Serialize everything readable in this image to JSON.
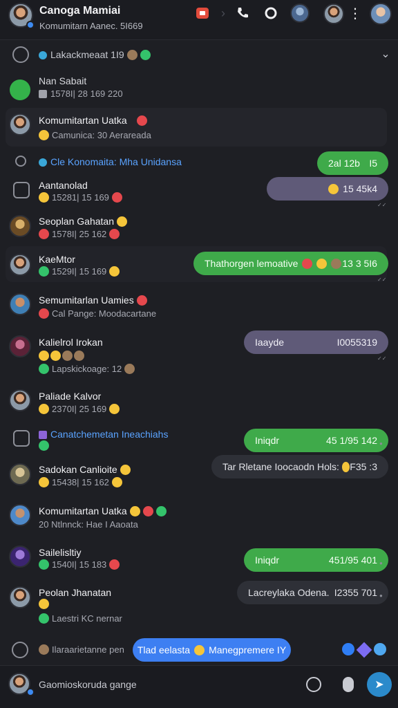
{
  "header": {
    "title": "Canoga Mamiai",
    "subtitle": "Komumitarn Aanec. 5I669"
  },
  "summary": {
    "label": "Lakackmeaat 1I9"
  },
  "pinned": {
    "name": "Nan Sabait",
    "meta": "1578I| 28 169 220"
  },
  "rows": [
    {
      "name": "Komumitartan Uatka",
      "meta": "Camunica: 30 Aerareada"
    },
    {
      "name": "Aantanolad",
      "meta": "15281| 15 169"
    },
    {
      "name": "Seoplan Gahatan",
      "meta": "1578I| 25 162"
    },
    {
      "name": "KaeMtor",
      "meta": "1529I| 15 169"
    },
    {
      "name": "Semumitarlan Uamies",
      "meta": "Cal Pange: Moodacartane"
    },
    {
      "name": "Kalielrol Irokan",
      "meta": "Lapskickoage: 12"
    },
    {
      "name": "Paliade Kalvor",
      "meta": "2370I| 25 169"
    },
    {
      "name": "Sadokan Canlioite",
      "meta": "15438| 15 162"
    },
    {
      "name": "Komumitartan Uatka",
      "meta": "20 Ntlnnck: Hae I Aaoata"
    },
    {
      "name": "Sailelisltiy",
      "meta": "1540I| 15 183"
    },
    {
      "name": "Peolan Jhanatan",
      "meta": "Laestri KC nernar"
    }
  ],
  "system_lines": {
    "link1": "Cle Konomaita: Mha Unidansa",
    "link2": "Canatchemetan Ineachiahs"
  },
  "bubbles": {
    "b1": {
      "left": "2al 12b",
      "right": "I5"
    },
    "b2": {
      "left": "",
      "right": "15 45k4"
    },
    "b3": {
      "left": "Thathorgen lemoative",
      "right": "13 3 5I6"
    },
    "b4": {
      "left": "Iaayde",
      "right": "I0055319"
    },
    "b5": {
      "left": "Iniqdr",
      "right": "45 1/95 142"
    },
    "b6": {
      "left": "Tar Rletane Ioocaodn Hols:",
      "right": "F35 :3"
    },
    "b7": {
      "left": "Iniqdr",
      "right": "451/95 401"
    },
    "b8": {
      "left": "Lacreylaka Odena.",
      "right": "I2355 701"
    }
  },
  "quick_reply": {
    "hint": "Ilaraarietanne pen",
    "pill_left": "Tlad eelasta",
    "pill_right": "Manegpremere IY"
  },
  "composer": {
    "placeholder": "Gaomioskoruda gange"
  },
  "colors": {
    "green_bubble": "#3faa4a",
    "accent_blue": "#3d7ff2",
    "link_blue": "#5aa3ff",
    "background": "#1e1f24"
  },
  "icons": [
    "back-arrow-icon",
    "phone-icon",
    "video-icon",
    "more-vertical-icon",
    "chevron-down-icon",
    "send-icon",
    "mic-icon",
    "camera-icon"
  ]
}
